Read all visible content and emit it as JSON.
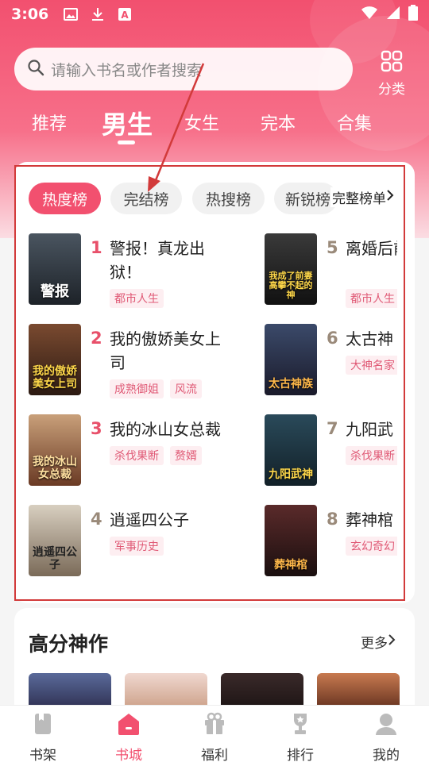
{
  "status_bar": {
    "time": "3:06",
    "icons": [
      "image-icon",
      "download-icon",
      "app-a-icon",
      "wifi-icon",
      "signal-icon",
      "battery-icon"
    ]
  },
  "search": {
    "placeholder": "请输入书名或作者搜索"
  },
  "category": {
    "label": "分类"
  },
  "gender_tabs": {
    "items": [
      "推荐",
      "男生",
      "女生",
      "完本",
      "合集"
    ],
    "active": "男生"
  },
  "rank_chips": {
    "items": [
      "热度榜",
      "完结榜",
      "热搜榜",
      "新锐榜"
    ],
    "active": "热度榜",
    "full_rank": "完整榜单"
  },
  "books": [
    {
      "rank": "1",
      "title": "警报！真龙出狱！",
      "cover_text": "警报",
      "tags": [
        "都市人生"
      ]
    },
    {
      "rank": "2",
      "title": "我的傲娇美女上司",
      "cover_text": "我的傲娇美女上司",
      "tags": [
        "成熟御姐",
        "风流"
      ]
    },
    {
      "rank": "3",
      "title": "我的冰山女总裁",
      "cover_text": "我的冰山女总裁",
      "tags": [
        "杀伐果断",
        "赘婿"
      ]
    },
    {
      "rank": "4",
      "title": "逍遥四公子",
      "cover_text": "逍遥四公子",
      "tags": [
        "军事历史"
      ]
    },
    {
      "rank": "5",
      "title": "离婚后前妻高",
      "cover_text": "我成了前妻高攀不起的神",
      "tags": [
        "都市人生"
      ]
    },
    {
      "rank": "6",
      "title": "太古神",
      "cover_text": "太古神族",
      "tags": [
        "大神名家"
      ]
    },
    {
      "rank": "7",
      "title": "九阳武",
      "cover_text": "九阳武神",
      "tags": [
        "杀伐果断"
      ]
    },
    {
      "rank": "8",
      "title": "葬神棺",
      "cover_text": "葬神棺",
      "tags": [
        "玄幻奇幻"
      ]
    }
  ],
  "section": {
    "title": "高分神作",
    "more": "更多"
  },
  "bottom_nav": {
    "items": [
      "书架",
      "书城",
      "福利",
      "排行",
      "我的"
    ],
    "active": "书城"
  },
  "colors": {
    "accent": "#f2506f",
    "rank_top": "#e8506a",
    "rank_other": "#9a8a7a",
    "tag_text": "#e05a76",
    "annotation": "#d23a3a"
  }
}
